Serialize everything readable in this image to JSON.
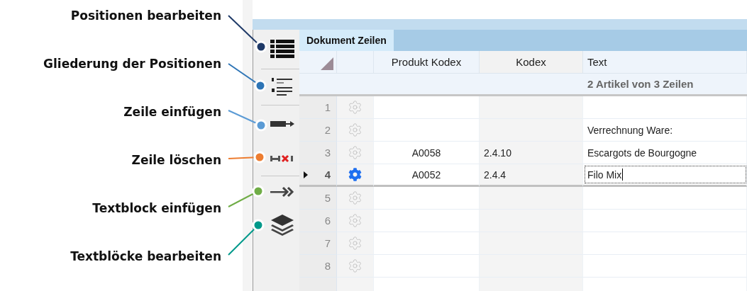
{
  "callouts": [
    {
      "label": "Positionen bearbeiten",
      "color": "#1f3a68"
    },
    {
      "label": "Gliederung der Positionen",
      "color": "#2e75b6"
    },
    {
      "label": "Zeile einfügen",
      "color": "#5b9bd5"
    },
    {
      "label": "Zeile löschen",
      "color": "#ed7d31"
    },
    {
      "label": "Textblock einfügen",
      "color": "#70ad47"
    },
    {
      "label": "Textblöcke bearbeiten",
      "color": "#00998a"
    }
  ],
  "toolbar": [
    {
      "kind": "list"
    },
    {
      "kind": "numbered"
    },
    {
      "kind": "insert"
    },
    {
      "kind": "delete"
    },
    {
      "kind": "arrows"
    },
    {
      "kind": "layers"
    }
  ],
  "tab": {
    "label": "Dokument Zeilen",
    "selected": true
  },
  "columns": [
    "Produkt Kodex",
    "Kodex",
    "Text"
  ],
  "summary": "2 Artikel von 3 Zeilen",
  "rows": [
    {
      "number": "1",
      "selected": false,
      "editing": false
    },
    {
      "number": "2",
      "selected": false,
      "editing": false,
      "text": "Verrechnung Ware:"
    },
    {
      "number": "3",
      "selected": false,
      "editing": false,
      "product": "A0058",
      "code": "2.4.10",
      "text": "Escargots de Bourgogne"
    },
    {
      "number": "4",
      "selected": true,
      "editing": true,
      "product": "A0052",
      "code": "2.4.4",
      "text": "Filo Mix"
    },
    {
      "number": "5",
      "selected": false,
      "editing": false
    },
    {
      "number": "6",
      "selected": false,
      "editing": false
    },
    {
      "number": "7",
      "selected": false,
      "editing": false
    },
    {
      "number": "8",
      "selected": false,
      "editing": false
    }
  ]
}
